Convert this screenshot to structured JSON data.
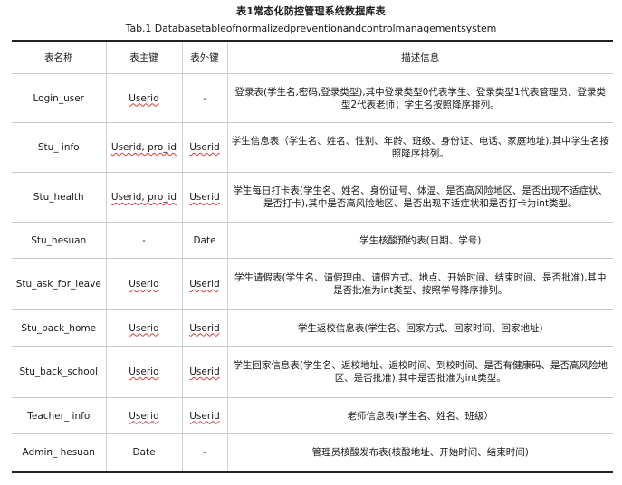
{
  "caption": {
    "cn": "表1常态化防控管理系统数据库表",
    "en": "Tab.1 Databasetableofnormalizedpreventionandcontrolmanagementsystem"
  },
  "headers": [
    "表名称",
    "表主键",
    "表外键",
    "描述信息"
  ],
  "rows": [
    {
      "name": "Login_user",
      "pk": "Userid",
      "fk": "-",
      "desc": "登录表(学生名,密码,登录类型),其中登录类型0代表学生、登录类型1代表管理员、登录类型2代表老师；学生名按照降序排列。"
    },
    {
      "name": "Stu_ info",
      "pk": "Userid, pro_id",
      "fk": "Userid",
      "desc": "学生信息表（学生名、姓名、性别、年龄、班级、身份证、电话、家庭地址),其中学生名按照降序排列。"
    },
    {
      "name": "Stu_health",
      "pk": "Userid, pro_id",
      "fk": "Userid",
      "desc": "学生每日打卡表(学生名、姓名、身份证号、体温、是否高风险地区、是否出现不适症状、是否打卡),其中是否高风险地区、是否出现不适症状和是否打卡为int类型。"
    },
    {
      "name": "Stu_hesuan",
      "pk": "-",
      "fk": "Date",
      "desc": "学生核酸预约表(日期、学号)"
    },
    {
      "name": "Stu_ask_for_leave",
      "pk": "Userid",
      "fk": "Userid",
      "desc": "学生请假表(学生名、请假理由、请假方式、地点、开始时间、结束时间、是否批准),其中是否批准为int类型、按照学号降序排列。"
    },
    {
      "name": "Stu_back_home",
      "pk": "Userid",
      "fk": "Userid",
      "desc": "学生返校信息表(学生名、回家方式、回家时间、回家地址)"
    },
    {
      "name": "Stu_back_school",
      "pk": "Userid",
      "fk": "Userid",
      "desc": "学生回家信息表(学生名、返校地址、返校时间、到校时间、是否有健康码、是否高风险地区、是否批准),其中是否批准为int类型。"
    },
    {
      "name": "Teacher_ info",
      "pk": "Userid",
      "fk": "Userid",
      "desc": "老师信息表(学生名、姓名、班级）"
    },
    {
      "name": "Admin_ hesuan",
      "pk": "Date",
      "fk": "-",
      "desc": "管理员核酸发布表(核酸地址、开始时间、结束时间)"
    }
  ]
}
